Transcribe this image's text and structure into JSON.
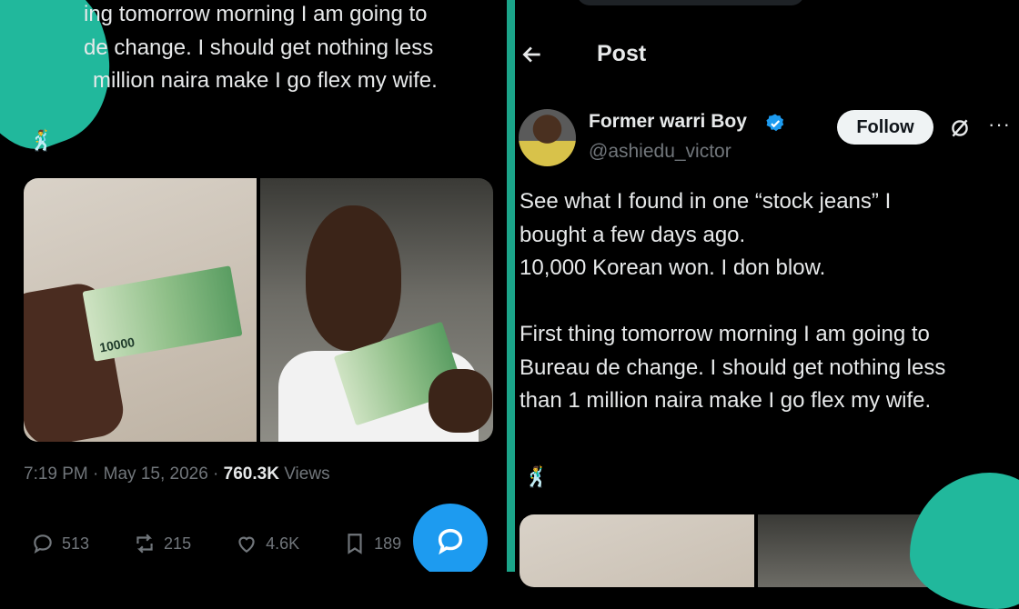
{
  "left_post": {
    "text_lines": [
      "ing tomorrow morning I am going to",
      "de change. I should get nothing less",
      "million naira make I go flex my wife."
    ],
    "emoji": "🕺",
    "timestamp": "7:19 PM · May 15, 2026 · ",
    "views_count": "760.3K",
    "views_label": " Views",
    "actions": {
      "replies": "513",
      "reposts": "215",
      "likes": "4.6K",
      "bookmarks": "189"
    },
    "banknote_value": "10000"
  },
  "right_post": {
    "header_title": "Post",
    "display_name": "Former warri Boy",
    "handle": "@ashiedu_victor",
    "follow_label": "Follow",
    "more_label": "···",
    "text_lines": [
      "See what I found in one “stock jeans” I",
      "bought a few days ago.",
      "10,000 Korean won. I don blow.",
      "",
      "First thing tomorrow morning I am going to",
      "Bureau de change. I should get nothing less",
      "than 1 million naira make I go flex my wife."
    ],
    "emoji": "🕺"
  },
  "colors": {
    "accent_blue": "#1d9bf0",
    "divider_green": "#1ba58a",
    "muted_text": "#71767b"
  },
  "icons": [
    "back-arrow-icon",
    "verified-badge-icon",
    "grok-icon",
    "reply-icon",
    "repost-icon",
    "like-icon",
    "bookmark-icon",
    "compose-reply-icon"
  ]
}
